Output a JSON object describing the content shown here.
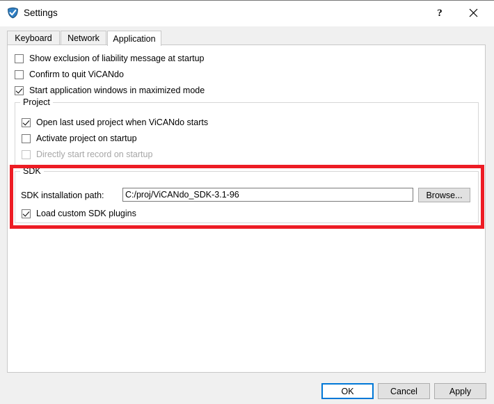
{
  "window": {
    "title": "Settings",
    "icon": "shield-check-icon"
  },
  "titlebar_buttons": {
    "help": "?",
    "close": "✕"
  },
  "tabs": [
    {
      "id": "keyboard",
      "label": "Keyboard",
      "selected": false
    },
    {
      "id": "network",
      "label": "Network",
      "selected": false
    },
    {
      "id": "application",
      "label": "Application",
      "selected": true
    }
  ],
  "application_tab": {
    "general_options": [
      {
        "label": "Show exclusion of liability message at startup",
        "checked": false,
        "enabled": true
      },
      {
        "label": "Confirm to quit ViCANdo",
        "checked": false,
        "enabled": true
      },
      {
        "label": "Start application windows in maximized mode",
        "checked": true,
        "enabled": true
      }
    ],
    "project_group": {
      "title": "Project",
      "options": [
        {
          "label": "Open last used project when ViCANdo starts",
          "checked": true,
          "enabled": true
        },
        {
          "label": "Activate project on startup",
          "checked": false,
          "enabled": true
        },
        {
          "label": "Directly start record  on startup",
          "checked": false,
          "enabled": false
        }
      ]
    },
    "sdk_group": {
      "title": "SDK",
      "path_label": "SDK installation path:",
      "path_value": "C:/proj/ViCANdo_SDK-3.1-96",
      "path_placeholder": "",
      "browse_label": "Browse...",
      "plugins_option": {
        "label": "Load custom SDK plugins",
        "checked": true,
        "enabled": true
      },
      "highlight_color": "#ed1c24"
    }
  },
  "footer": {
    "ok": "OK",
    "cancel": "Cancel",
    "apply": "Apply",
    "default_button": "ok",
    "focus_color": "#0078d7"
  }
}
